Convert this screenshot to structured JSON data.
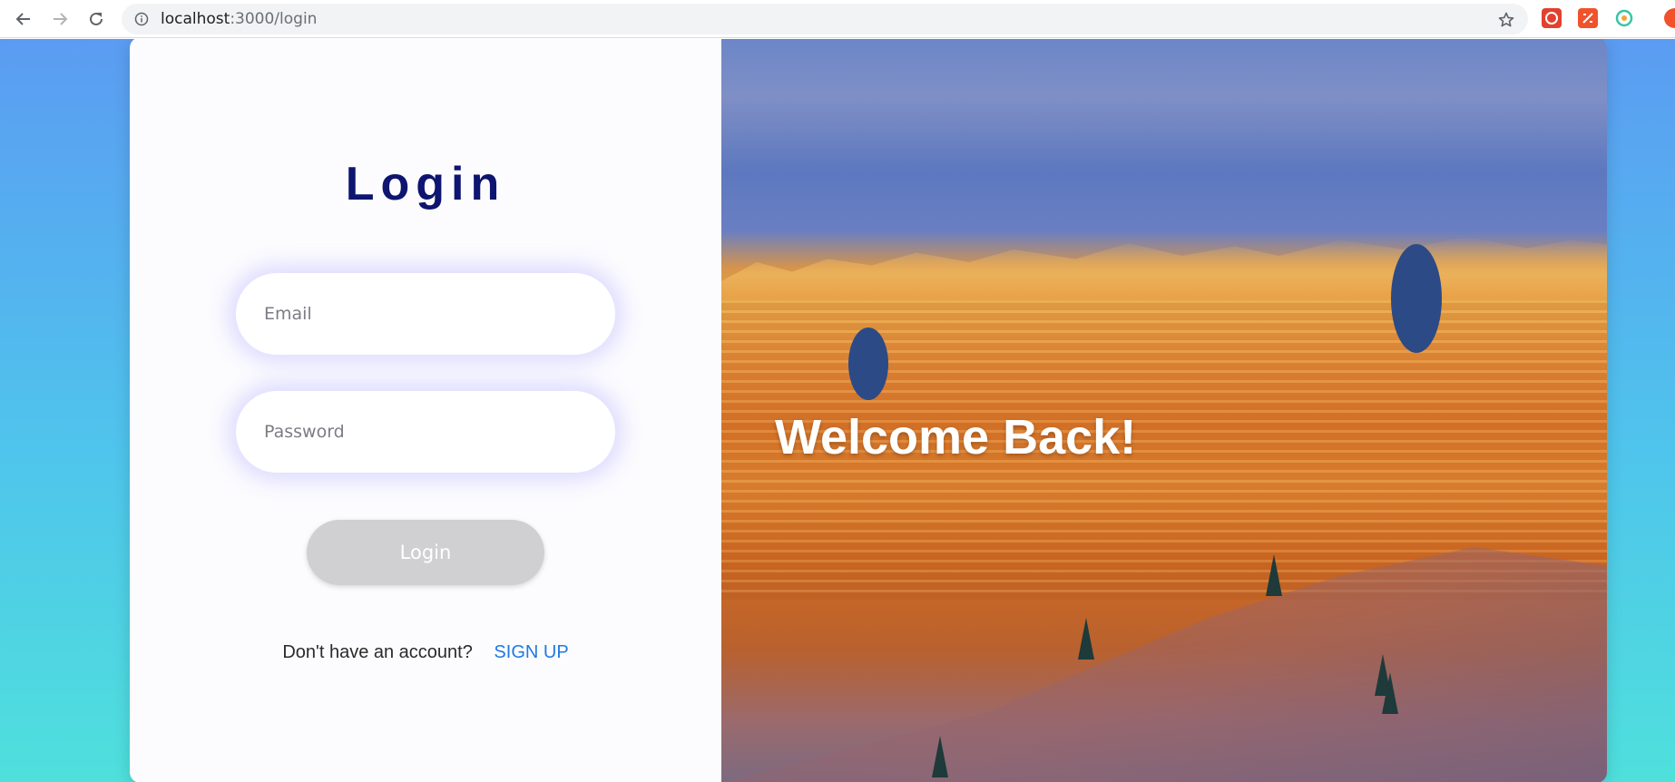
{
  "browser": {
    "url_host": "localhost",
    "url_path": ":3000/login"
  },
  "login": {
    "title": "Login",
    "email_placeholder": "Email",
    "password_placeholder": "Password",
    "submit_label": "Login",
    "signup_prompt": "Don't have an account?",
    "signup_link": "SIGN UP"
  },
  "hero": {
    "heading": "Welcome Back!"
  },
  "colors": {
    "title": "#0d1570",
    "link": "#1f7ae0",
    "button_disabled": "#d0d0d3",
    "gradient_top": "#5b9cf2",
    "gradient_bottom": "#4fe0dc"
  },
  "icons": [
    "back-icon",
    "forward-icon",
    "reload-icon",
    "info-icon",
    "bookmark-star-icon"
  ]
}
